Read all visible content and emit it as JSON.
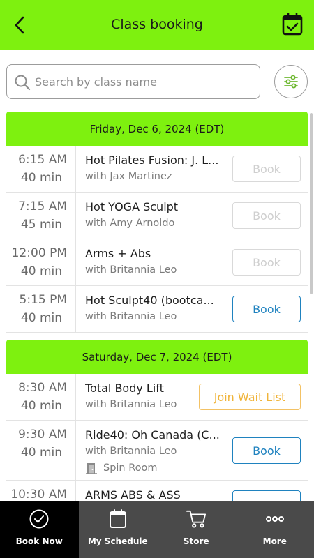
{
  "header": {
    "title": "Class booking",
    "back_icon": "chevron-left-icon",
    "calendar_icon": "calendar-check-icon"
  },
  "search": {
    "placeholder": "Search by class name",
    "value": ""
  },
  "filter": {
    "icon": "sliders-icon"
  },
  "colors": {
    "accent": "#7ef10f",
    "book_blue": "#1f82bf",
    "waitlist_orange": "#f0b43a",
    "tabbar": "#4a4a4a"
  },
  "days": [
    {
      "date": "Friday, Dec 6, 2024 (EDT)",
      "classes": [
        {
          "time": "6:15  AM",
          "duration": "40 min",
          "name": "Hot Pilates Fusion: J. L...",
          "instructor": "with Jax Martinez",
          "action": "Book",
          "state": "disabled"
        },
        {
          "time": "7:15  AM",
          "duration": "45 min",
          "name": "Hot YOGA Sculpt",
          "instructor": "with Amy Arnoldo",
          "action": "Book",
          "state": "disabled"
        },
        {
          "time": "12:00  PM",
          "duration": "40 min",
          "name": "Arms + Abs",
          "instructor": "with Britannia Leo",
          "action": "Book",
          "state": "disabled"
        },
        {
          "time": "5:15  PM",
          "duration": "40 min",
          "name": "Hot Sculpt40 (bootca...",
          "instructor": "with Britannia Leo",
          "action": "Book",
          "state": "enabled"
        }
      ]
    },
    {
      "date": "Saturday, Dec 7, 2024 (EDT)",
      "classes": [
        {
          "time": "8:30  AM",
          "duration": "40 min",
          "name": "Total Body Lift",
          "instructor": "with Britannia Leo",
          "action": "Join Wait List",
          "state": "waitlist"
        },
        {
          "time": "9:30  AM",
          "duration": "40 min",
          "name": "Ride40: Oh Canada (C...",
          "instructor": "with Britannia Leo",
          "room": "Spin Room",
          "action": "Book",
          "state": "enabled"
        },
        {
          "time": "10:30  AM",
          "duration": "",
          "name": "ARMS ABS & ASS",
          "instructor": "",
          "action": "",
          "state": "enabled"
        }
      ]
    }
  ],
  "tabs": [
    {
      "label": "Book Now",
      "icon": "check-circle-icon",
      "active": true
    },
    {
      "label": "My Schedule",
      "icon": "calendar-icon",
      "active": false
    },
    {
      "label": "Store",
      "icon": "cart-icon",
      "active": false
    },
    {
      "label": "More",
      "icon": "more-dots-icon",
      "active": false
    }
  ]
}
